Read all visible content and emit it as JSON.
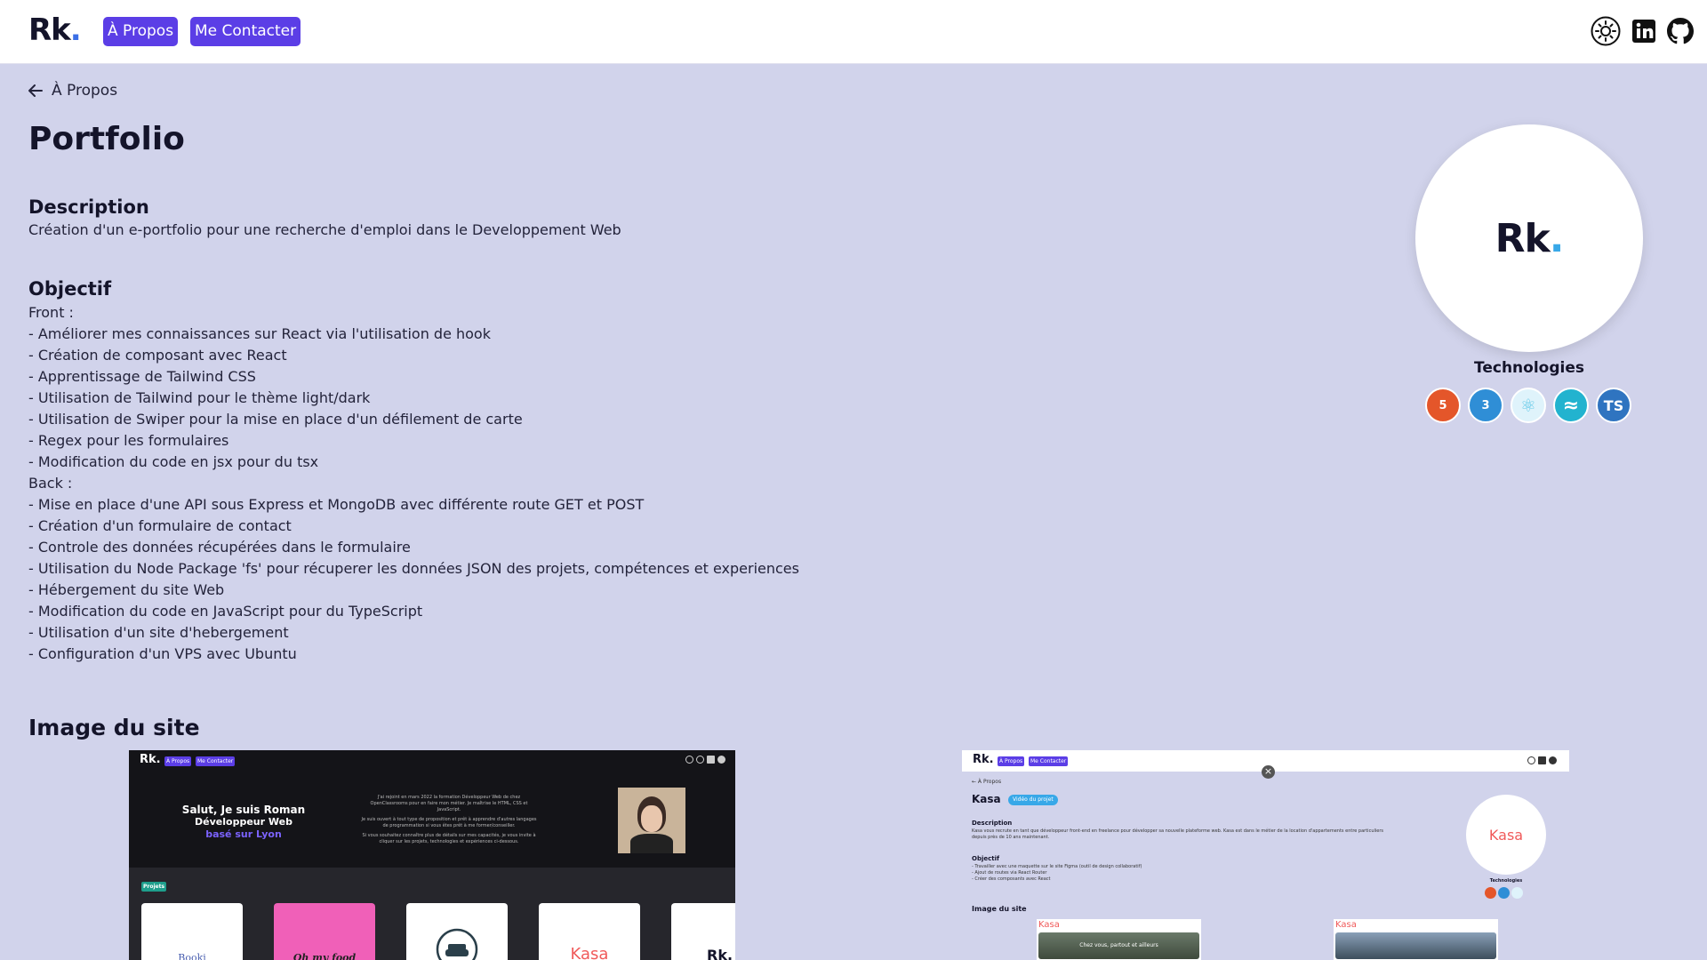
{
  "header": {
    "logo_text": "Rk",
    "logo_dot": ".",
    "nav": [
      {
        "label": "À Propos"
      },
      {
        "label": "Me Contacter"
      }
    ],
    "icons": [
      "theme-toggle-icon",
      "linkedin-icon",
      "github-icon"
    ],
    "accent_color": "#5b3ee6"
  },
  "back_link": {
    "label": "À Propos"
  },
  "project": {
    "title": "Portfolio",
    "description_heading": "Description",
    "description": "Création d'un e-portfolio pour une recherche d'emploi dans le Developpement Web",
    "objective_heading": "Objectif",
    "objectives": [
      "Front :",
      "- Améliorer mes connaissances sur React via l'utilisation de hook",
      "- Création de composant avec React",
      "- Apprentissage de Tailwind CSS",
      "- Utilisation de Tailwind pour le thème light/dark",
      "- Utilisation de Swiper pour la mise en place d'un défilement de carte",
      "- Regex pour les formulaires",
      "- Modification du code en jsx pour du tsx",
      "Back :",
      "- Mise en place d'une API sous Express et MongoDB avec différente route GET et POST",
      "- Création d'un formulaire de contact",
      "- Controle des données récupérées dans le formulaire",
      "- Utilisation du Node Package 'fs' pour récuperer les données JSON des projets, compétences et experiences",
      "- Hébergement du site Web",
      "- Modification du code en JavaScript pour du TypeScript",
      "- Utilisation d'un site d'hebergement",
      "- Configuration d'un VPS avec Ubuntu"
    ],
    "images_heading": "Image du site"
  },
  "sidebar": {
    "logo_text": "Rk",
    "logo_dot": ".",
    "tech_heading": "Technologies",
    "technologies": [
      {
        "name": "html5-icon",
        "label": "5",
        "color": "#e4562a"
      },
      {
        "name": "css3-icon",
        "label": "3",
        "color": "#2f8ed6"
      },
      {
        "name": "react-icon",
        "label": "⚛",
        "color": "#dff3fb"
      },
      {
        "name": "tailwind-icon",
        "label": "≈",
        "color": "#22b3cf"
      },
      {
        "name": "typescript-icon",
        "label": "TS",
        "color": "#2f74c0"
      }
    ]
  },
  "screenshot1": {
    "logo": "Rk.",
    "nav": [
      "À Propos",
      "Me Contacter"
    ],
    "hero_line1": "Salut, Je suis Roman",
    "hero_line2": "Développeur Web",
    "hero_line3": "basé sur Lyon",
    "intro_a": "J'ai rejoint en mars 2022 la formation Développeur Web de chez",
    "intro_b": "OpenClassrooms pour en faire mon métier. Je maîtrise le HTML, CSS et",
    "intro_c": "JavaScript.",
    "intro_d": "Je suis ouvert à tout type de proposition et prêt à apprendre d'autres langages",
    "intro_e": "de programmation si vous êtes prêt à me former/conseiller.",
    "intro_f": "Si vous souhaitez connaître plus de détails sur mes capacités, je vous invite à",
    "intro_g": "cliquer sur les projets, technologies et expériences ci-dessous.",
    "projects_label": "Projets",
    "cards": [
      "Booki",
      "Oh my food",
      "",
      "Kasa",
      "Rk."
    ]
  },
  "screenshot2": {
    "logo": "Rk.",
    "nav": [
      "À Propos",
      "Me Contacter"
    ],
    "back": "← À Propos",
    "title": "Kasa",
    "badge": "Vidéo du projet",
    "desc_heading": "Description",
    "desc_a": "Kasa vous recrute en tant que développeur front-end en freelance pour développer sa nouvelle plateforme web. Kasa est dans le métier de la location d'appartements entre particuliers",
    "desc_b": "depuis près de 10 ans maintenant.",
    "obj_heading": "Objectif",
    "obj_a": "- Travailler avec une maquette sur le site Figma (outil de design collaboratif)",
    "obj_b": "- Ajout de routes via React Router",
    "obj_c": "- Créer des composants avec React",
    "img_heading": "Image du site",
    "circle_text": "Kasa",
    "tech_heading": "Technologies",
    "banner_text": "Chez vous, partout et ailleurs",
    "thumb_logo": "Kasa",
    "close": "×"
  }
}
